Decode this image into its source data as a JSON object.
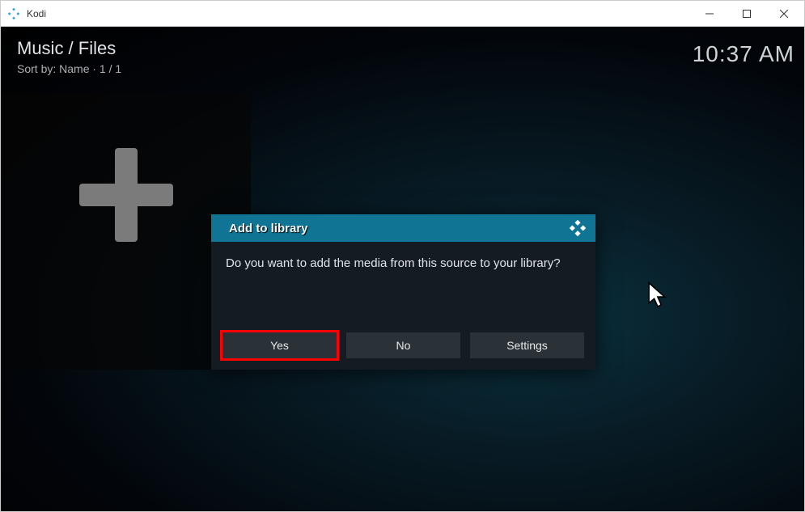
{
  "window": {
    "title": "Kodi"
  },
  "header": {
    "breadcrumb": "Music / Files",
    "sort": "Sort by: Name  ·  1 / 1",
    "clock": "10:37 AM"
  },
  "dialog": {
    "title": "Add to library",
    "message": "Do you want to add the media from this source to your library?",
    "buttons": {
      "yes": "Yes",
      "no": "No",
      "settings": "Settings"
    }
  }
}
